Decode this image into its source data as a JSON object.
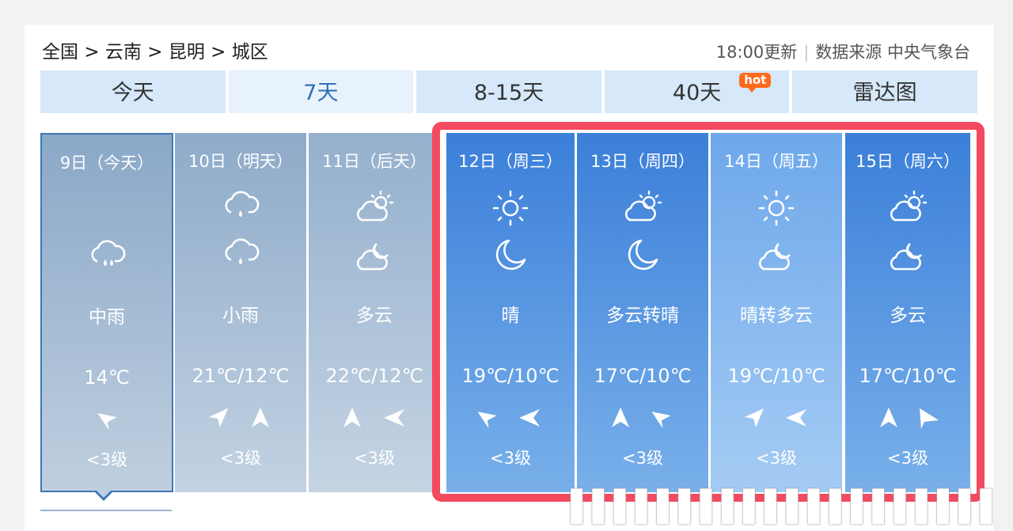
{
  "breadcrumb": [
    "全国",
    "云南",
    "昆明",
    "城区"
  ],
  "breadcrumb_sep": ">",
  "update_time": "18:00更新",
  "source": "数据来源 中央气象台",
  "tabs": [
    {
      "label": "今天"
    },
    {
      "label": "7天",
      "active": true
    },
    {
      "label": "8-15天"
    },
    {
      "label": "40天",
      "badge": "hot"
    },
    {
      "label": "雷达图"
    }
  ],
  "days": [
    {
      "date": "9日（今天）",
      "icon_day": "rain-icon",
      "icon_night": null,
      "condition": "中雨",
      "temp": "14℃",
      "wind_dirs": [
        "arrow-right-icon"
      ],
      "wind_level": "<3级"
    },
    {
      "date": "10日（明天）",
      "icon_day": "rain-icon",
      "icon_night": "rain-icon",
      "condition": "小雨",
      "temp": "21℃/12℃",
      "wind_dirs": [
        "arrow-upright-icon",
        "arrow-up-icon"
      ],
      "wind_level": "<3级"
    },
    {
      "date": "11日（后天）",
      "icon_day": "cloudy-sun-icon",
      "icon_night": "cloudy-moon-icon",
      "condition": "多云",
      "temp": "22℃/12℃",
      "wind_dirs": [
        "arrow-up-icon",
        "arrow-left-icon"
      ],
      "wind_level": "<3级"
    },
    {
      "date": "12日（周三）",
      "icon_day": "sun-icon",
      "icon_night": "moon-icon",
      "condition": "晴",
      "temp": "19℃/10℃",
      "wind_dirs": [
        "arrow-right-icon",
        "arrow-left-icon"
      ],
      "wind_level": "<3级"
    },
    {
      "date": "13日（周四）",
      "icon_day": "cloudy-sun-icon",
      "icon_night": "moon-icon",
      "condition": "多云转晴",
      "temp": "17℃/10℃",
      "wind_dirs": [
        "arrow-up-icon",
        "arrow-right-icon"
      ],
      "wind_level": "<3级"
    },
    {
      "date": "14日（周五）",
      "icon_day": "sun-icon",
      "icon_night": "cloudy-moon-icon",
      "condition": "晴转多云",
      "temp": "19℃/10℃",
      "wind_dirs": [
        "arrow-upright-icon",
        "arrow-left-icon"
      ],
      "wind_level": "<3级"
    },
    {
      "date": "15日（周六）",
      "icon_day": "cloudy-sun-icon",
      "icon_night": "cloudy-moon-icon",
      "condition": "多云",
      "temp": "17℃/10℃",
      "wind_dirs": [
        "arrow-up-icon",
        "arrow-downright-icon"
      ],
      "wind_level": "<3级"
    }
  ],
  "colors": {
    "highlight": "#f44a5f",
    "tab_bg": "#d6e8f9",
    "tab_active_text": "#2f6fb0",
    "hot_badge": "#ff6a1a"
  }
}
